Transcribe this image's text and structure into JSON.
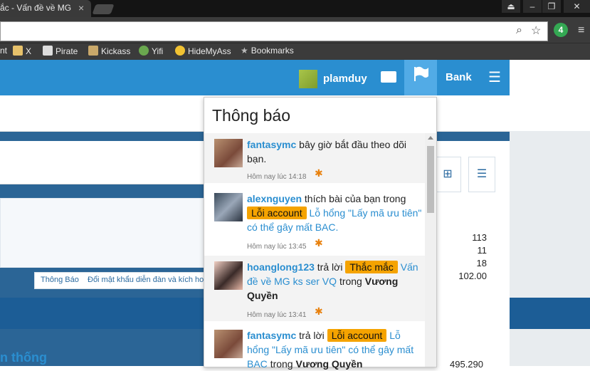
{
  "browser": {
    "tab_title": "ắc - Vấn đề về MG",
    "tab_close": "×",
    "bookmarks": [
      {
        "label": "nt"
      },
      {
        "label": "X"
      },
      {
        "label": "Pirate"
      },
      {
        "label": "Kickass"
      },
      {
        "label": "Yifi"
      },
      {
        "label": "HideMyAss"
      },
      {
        "label": "Bookmarks"
      }
    ],
    "ext_badge": "4"
  },
  "nav": {
    "username": "plamduy",
    "bank_label": "Bank"
  },
  "notifications": {
    "title": "Thông báo",
    "items": [
      {
        "user": "fantasymc",
        "text": "bây giờ bắt đầu theo dõi bạn.",
        "time": "Hôm nay lúc 14:18"
      },
      {
        "user": "alexnguyen",
        "text": "thích bài của bạn trong",
        "tag": "Lỗi account",
        "link": "Lỗ hổng \"Lấy mã ưu tiên\" có thể gây mất BAC.",
        "time": "Hôm nay lúc 13:45"
      },
      {
        "user": "hoanglong123",
        "text": "trả lời",
        "tag": "Thắc mắc",
        "link": "Vấn đề về MG ks ser VQ",
        "text2": "trong",
        "thread_owner": "Vương Quyền",
        "time": "Hôm nay lúc 13:41"
      },
      {
        "user": "fantasymc",
        "text": "trả lời",
        "tag": "Lỗi account",
        "link": "Lỗ hổng \"Lấy mã ưu tiên\" có thể gây mất BAC",
        "text2": "trong",
        "thread_owner": "Vương Quyền"
      }
    ]
  },
  "page": {
    "crumbs": [
      "Thông Báo",
      "Đổi mật khẩu diễn đàn và kích hoạ"
    ],
    "stats": [
      "113",
      "11",
      "18",
      "102.00"
    ],
    "bottom_stat": "495.290",
    "section_title": "n thống"
  },
  "colors": {
    "nav_blue": "#2a8ed0",
    "tag_orange": "#f5a300",
    "link_blue": "#2a8ed0"
  }
}
